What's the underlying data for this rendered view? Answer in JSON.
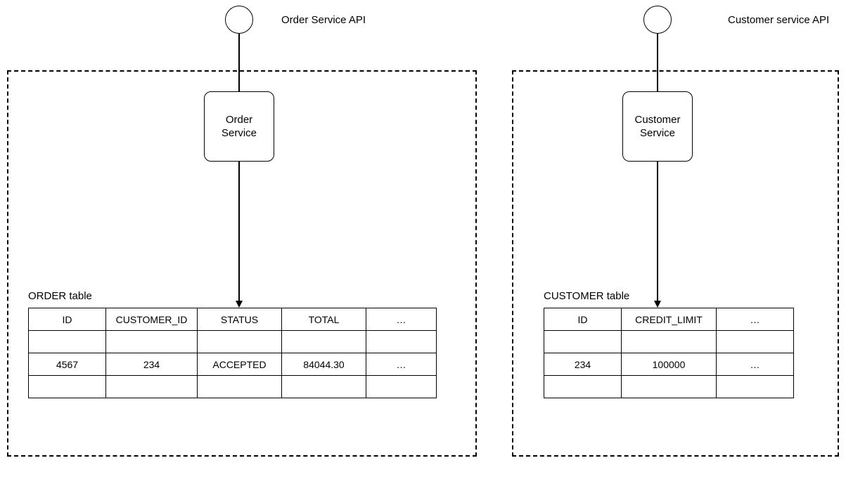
{
  "left": {
    "api_label": "Order Service API",
    "service_label": "Order\nService",
    "table_label": "ORDER table",
    "table": {
      "headers": [
        "ID",
        "CUSTOMER_ID",
        "STATUS",
        "TOTAL",
        "…"
      ],
      "rows": [
        [
          "",
          "",
          "",
          "",
          ""
        ],
        [
          "4567",
          "234",
          "ACCEPTED",
          "84044.30",
          "…"
        ],
        [
          "",
          "",
          "",
          "",
          ""
        ]
      ]
    }
  },
  "right": {
    "api_label": "Customer service API",
    "service_label": "Customer\nService",
    "table_label": "CUSTOMER table",
    "table": {
      "headers": [
        "ID",
        "CREDIT_LIMIT",
        "…"
      ],
      "rows": [
        [
          "",
          "",
          ""
        ],
        [
          "234",
          "100000",
          "…"
        ],
        [
          "",
          "",
          ""
        ]
      ]
    }
  }
}
